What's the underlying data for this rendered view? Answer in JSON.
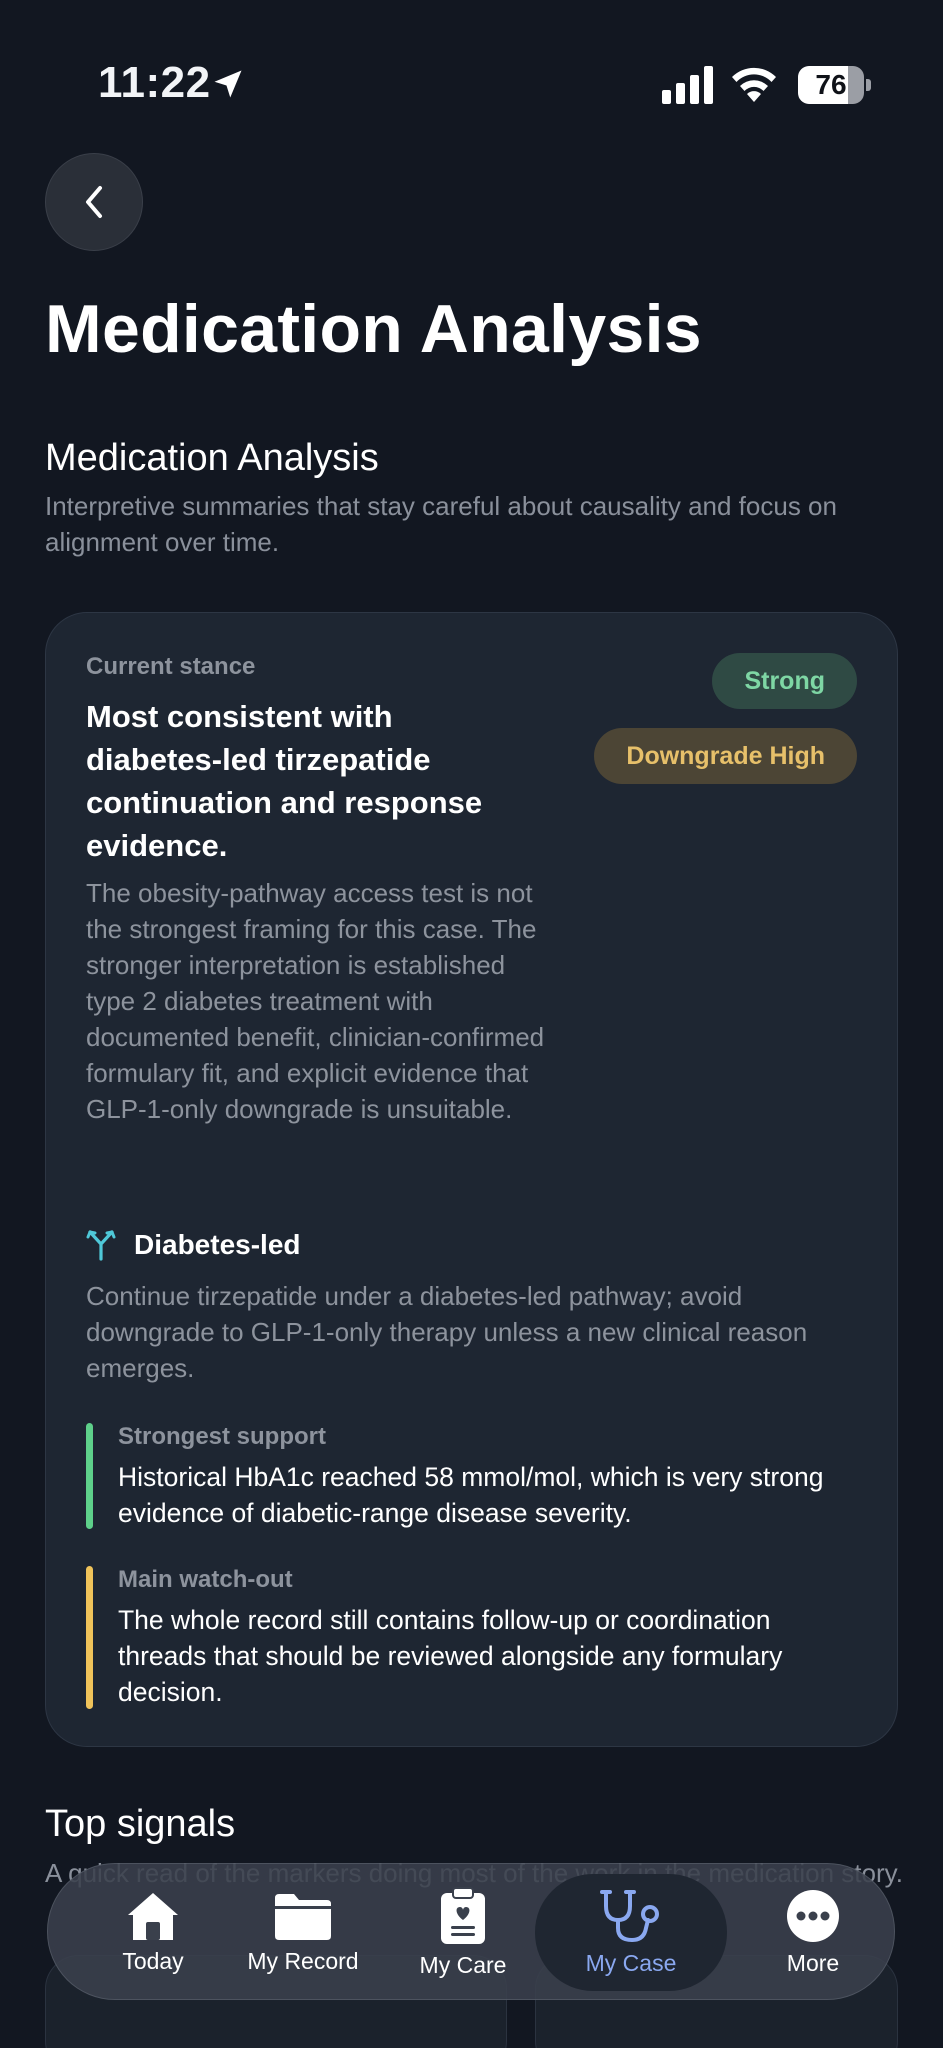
{
  "status_bar": {
    "time": "11:22",
    "battery": 76
  },
  "header": {
    "title": "Medication Analysis"
  },
  "analysis_section": {
    "title": "Medication Analysis",
    "subtitle": "Interpretive summaries that stay careful about causality and focus on alignment over time."
  },
  "stance_card": {
    "label": "Current stance",
    "headline": "Most consistent with diabetes-led tirzepatide continuation and response evidence.",
    "body": "The obesity-pathway access test is not the strongest framing for this case. The stronger interpretation is established type 2 diabetes treatment with documented benefit, clinician-confirmed formulary fit, and explicit evidence that GLP-1-only downgrade is unsuitable.",
    "badges": [
      {
        "label": "Strong",
        "color": "#7ed6a4"
      },
      {
        "label": "Downgrade High",
        "color": "#e7c06a"
      }
    ],
    "pathway": {
      "icon": "branch-merge-icon",
      "label": "Diabetes-led",
      "description": "Continue tirzepatide under a diabetes-led pathway; avoid downgrade to GLP-1-only therapy unless a new clinical reason emerges."
    },
    "evidence": [
      {
        "label": "Strongest support",
        "text": "Historical HbA1c reached 58 mmol/mol, which is very strong evidence of diabetic-range disease severity.",
        "accent": "#5ed08a"
      },
      {
        "label": "Main watch-out",
        "text": "The whole record still contains follow-up or coordination threads that should be reviewed alongside any formulary decision.",
        "accent": "#f0c35a"
      }
    ]
  },
  "signals_section": {
    "title": "Top signals",
    "subtitle": "A quick read of the markers doing most of the work in the medication story."
  },
  "tab_bar": {
    "tabs": [
      {
        "label": "Today",
        "icon": "home-icon",
        "active": false
      },
      {
        "label": "My Record",
        "icon": "folder-icon",
        "active": false
      },
      {
        "label": "My Care",
        "icon": "clipboard-heart-icon",
        "active": false
      },
      {
        "label": "My Case",
        "icon": "stethoscope-icon",
        "active": true
      },
      {
        "label": "More",
        "icon": "more-icon",
        "active": false
      }
    ],
    "active_color": "#8aa8f0"
  }
}
